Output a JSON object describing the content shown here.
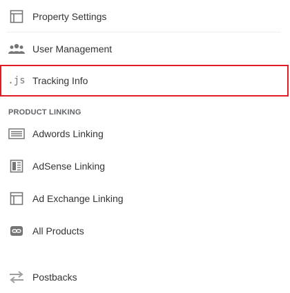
{
  "menu": {
    "items": [
      {
        "label": "Property Settings",
        "icon": "property-settings-icon"
      },
      {
        "label": "User Management",
        "icon": "users-icon"
      },
      {
        "label": "Tracking Info",
        "icon": "js-icon",
        "icon_text": ".js",
        "selected": true
      }
    ],
    "section_header": "PRODUCT LINKING",
    "product_items": [
      {
        "label": "Adwords Linking",
        "icon": "adwords-icon"
      },
      {
        "label": "AdSense Linking",
        "icon": "adsense-icon"
      },
      {
        "label": "Ad Exchange Linking",
        "icon": "ad-exchange-icon"
      },
      {
        "label": "All Products",
        "icon": "link-icon"
      }
    ],
    "postbacks": {
      "label": "Postbacks",
      "icon": "postbacks-icon"
    }
  },
  "colors": {
    "selected_border": "#e01b24",
    "icon": "#757575",
    "text": "#333333"
  }
}
